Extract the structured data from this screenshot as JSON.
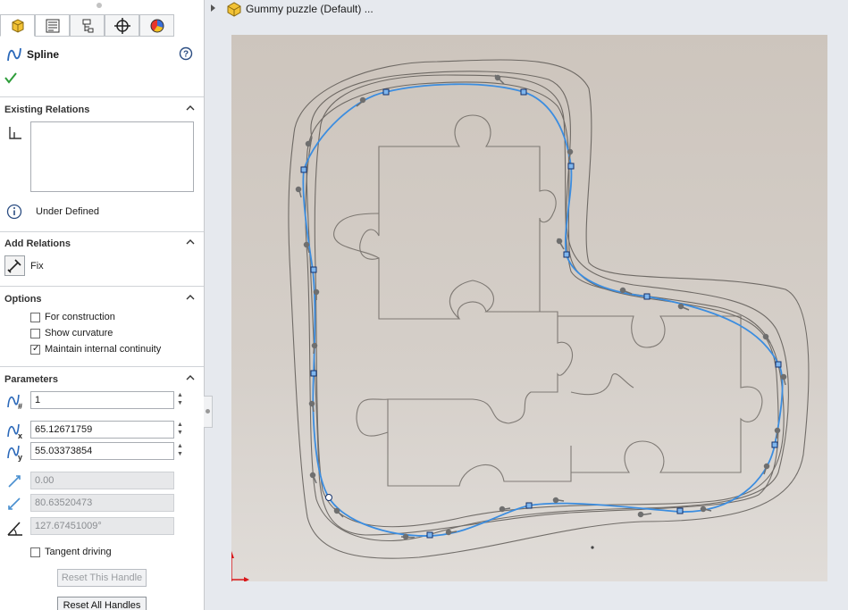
{
  "feature_tree": {
    "part_name": "Gummy puzzle (Default) ..."
  },
  "property_manager": {
    "title": "Spline",
    "existing_relations": {
      "label": "Existing Relations",
      "status": "Under Defined"
    },
    "add_relations": {
      "label": "Add Relations",
      "fix_label": "Fix"
    },
    "options": {
      "label": "Options",
      "for_construction": {
        "label": "For construction",
        "checked": false
      },
      "show_curvature": {
        "label": "Show curvature",
        "checked": false
      },
      "maintain_continuity": {
        "label": "Maintain internal continuity",
        "checked": true
      }
    },
    "parameters": {
      "label": "Parameters",
      "point_number": "1",
      "x_coordinate": "65.12671759",
      "y_coordinate": "55.03373854",
      "tangent_weight_1": "0.00",
      "tangent_weight_2": "80.63520473",
      "tangent_angle": "127.67451009°",
      "tangent_driving": {
        "label": "Tangent driving",
        "checked": false
      },
      "reset_this_label": "Reset This Handle",
      "reset_all_label": "Reset All Handles"
    }
  },
  "colors": {
    "spline": "#3b8de0",
    "background_image": "#cfc8c1",
    "ok_check": "#2e9d3a"
  }
}
